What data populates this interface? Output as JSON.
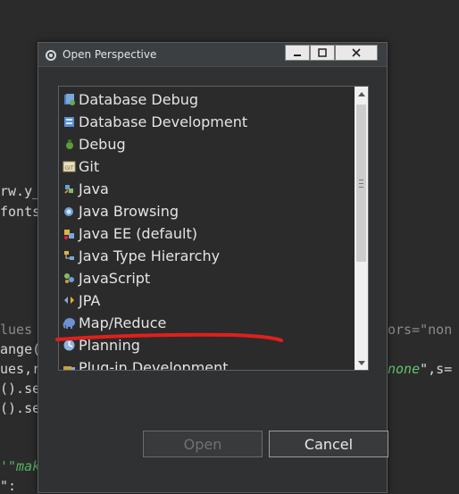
{
  "background_code": {
    "line1": "rw.y_",
    "line2": "fonts",
    "line3a": "lues",
    "line3b": "ors=\"non",
    "line4": "ange(",
    "line5a": "ues,r",
    "line5b": "none",
    "line5c": "\",s=",
    "line6": "().se",
    "line7": "().se",
    "line8": "'\"mak",
    "line9": "\":"
  },
  "dialog": {
    "title": "Open Perspective",
    "items": [
      {
        "label": "Database Debug",
        "icon": "database-debug-icon"
      },
      {
        "label": "Database Development",
        "icon": "database-development-icon"
      },
      {
        "label": "Debug",
        "icon": "debug-icon"
      },
      {
        "label": "Git",
        "icon": "git-icon"
      },
      {
        "label": "Java",
        "icon": "java-icon"
      },
      {
        "label": "Java Browsing",
        "icon": "java-browsing-icon"
      },
      {
        "label": "Java EE (default)",
        "icon": "java-ee-icon"
      },
      {
        "label": "Java Type Hierarchy",
        "icon": "java-type-hierarchy-icon"
      },
      {
        "label": "JavaScript",
        "icon": "javascript-icon"
      },
      {
        "label": "JPA",
        "icon": "jpa-icon"
      },
      {
        "label": "Map/Reduce",
        "icon": "map-reduce-elephant-icon"
      },
      {
        "label": "Planning",
        "icon": "planning-icon"
      },
      {
        "label": "Plug-in Development",
        "icon": "plugin-development-icon"
      }
    ],
    "buttons": {
      "open": "Open",
      "cancel": "Cancel"
    },
    "annotation_color": "#e0201c"
  }
}
